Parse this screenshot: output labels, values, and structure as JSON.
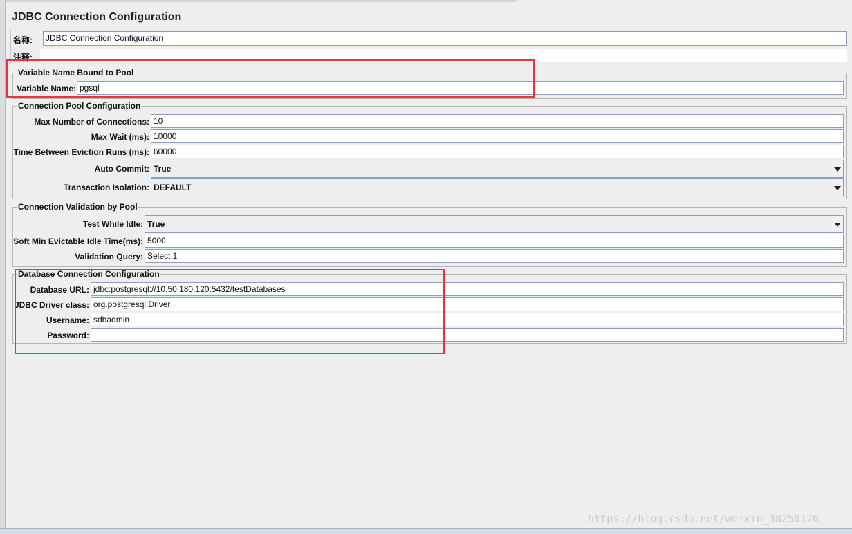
{
  "header": {
    "title": "JDBC Connection Configuration"
  },
  "general": {
    "name_label": "名称:",
    "name_value": "JDBC Connection Configuration",
    "comment_label": "注释:"
  },
  "variable_group": {
    "legend": "Variable Name Bound to Pool",
    "variable_name_label": "Variable Name:",
    "variable_name_value": "pgsql"
  },
  "pool_group": {
    "legend": "Connection Pool Configuration",
    "max_connections_label": "Max Number of Connections:",
    "max_connections_value": "10",
    "max_wait_label": "Max Wait (ms):",
    "max_wait_value": "10000",
    "eviction_label": "Time Between Eviction Runs (ms):",
    "eviction_value": "60000",
    "auto_commit_label": "Auto Commit:",
    "auto_commit_value": "True",
    "isolation_label": "Transaction Isolation:",
    "isolation_value": "DEFAULT"
  },
  "validation_group": {
    "legend": "Connection Validation by Pool",
    "test_idle_label": "Test While Idle:",
    "test_idle_value": "True",
    "soft_min_label": "Soft Min Evictable Idle Time(ms):",
    "soft_min_value": "5000",
    "query_label": "Validation Query:",
    "query_value": "Select 1"
  },
  "database_group": {
    "legend": "Database Connection Configuration",
    "url_label": "Database URL:",
    "url_value": "jdbc:postgresql://10.50.180.120:5432/testDatabases",
    "driver_label": "JDBC Driver class:",
    "driver_value": "org.postgresql.Driver",
    "username_label": "Username:",
    "username_value": "sdbadmin",
    "password_label": "Password:",
    "password_value": ""
  },
  "watermark": "https://blog.csdn.net/weixin_38250126",
  "colors": {
    "highlight": "#e8343c",
    "field_border": "#8a9fbf",
    "background": "#eeeeee"
  }
}
